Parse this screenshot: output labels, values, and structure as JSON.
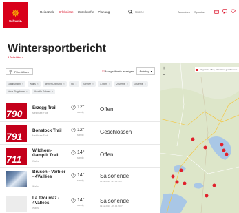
{
  "header": {
    "logo_text": "Schweiz.",
    "nav": [
      "Reiseziele",
      "Erlebnisse",
      "Unterkünfte",
      "Planung"
    ],
    "search_placeholder": "Suche",
    "utils": [
      "Anmelden",
      "Sprache"
    ]
  },
  "page": {
    "title": "Wintersportbericht",
    "subtitle": "5 Aktivitäten"
  },
  "filters": {
    "filter_button": "Filter öffnen",
    "only_open": "Nur geöffnete anzeigen",
    "sort_label": "Aufstieg",
    "chips": [
      "Graubünden",
      "Wallis",
      "Berner Oberland",
      "Ski",
      "Schnee",
      "1-Stern",
      "2 Sterne",
      "3 Sterne",
      "Neue Skigebiete",
      "Aktuelle Schnee"
    ]
  },
  "rows": [
    {
      "thumb": "790",
      "name": "Erzegg Trail",
      "location": "Melchsee-Frutt",
      "temp": "12°",
      "temp_sub": "sonnig",
      "status": "Offen",
      "dates": ""
    },
    {
      "thumb": "791",
      "name": "Bonstock Trail",
      "location": "Melchsee-Frutt",
      "temp": "12°",
      "temp_sub": "sonnig",
      "status": "Geschlossen",
      "dates": ""
    },
    {
      "thumb": "711",
      "name": "Wildhorn-Gampilt Trail",
      "location": "Wallis",
      "temp": "14°",
      "temp_sub": "sonnig",
      "status": "Offen",
      "dates": ""
    },
    {
      "thumb": "",
      "name": "Bruson - Verbier - 4Vallées",
      "location": "Wallis",
      "temp": "14°",
      "temp_sub": "sonnig",
      "status": "Saisonende",
      "dates": "04.12.2016 - 23.04.2017"
    },
    {
      "thumb": "",
      "name": "La Tzoumaz - 4Vallées",
      "location": "Wallis",
      "temp": "14°",
      "temp_sub": "sonnig",
      "status": "Saisonende",
      "dates": "09.12.2016 - 09.04.2017"
    }
  ],
  "map": {
    "legend": "Skigebiete offen, Aktivitäten geschlossen",
    "zoom_in": "+",
    "zoom_out": "−"
  },
  "colors": {
    "brand": "#d8001a",
    "marker": "#e0202b",
    "lake": "#a9c7e6",
    "land": "#d9e3c6"
  }
}
